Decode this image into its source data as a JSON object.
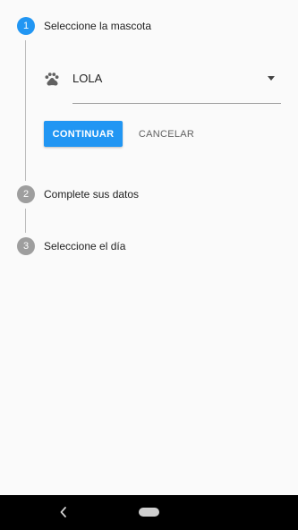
{
  "stepper": {
    "steps": [
      {
        "number": "1",
        "label": "Seleccione la mascota",
        "state": "active"
      },
      {
        "number": "2",
        "label": "Complete sus datos",
        "state": "inactive"
      },
      {
        "number": "3",
        "label": "Seleccione el día",
        "state": "inactive"
      }
    ]
  },
  "pet_select": {
    "icon": "paw-icon",
    "value": "LOLA"
  },
  "actions": {
    "continue_label": "CONTINUAR",
    "cancel_label": "CANCELAR"
  },
  "colors": {
    "accent": "#2196f3",
    "inactive_step": "#9e9e9e",
    "navbar": "#000000"
  },
  "system_nav": {
    "back_icon": "back-chevron-icon",
    "home_icon": "home-pill-icon"
  }
}
